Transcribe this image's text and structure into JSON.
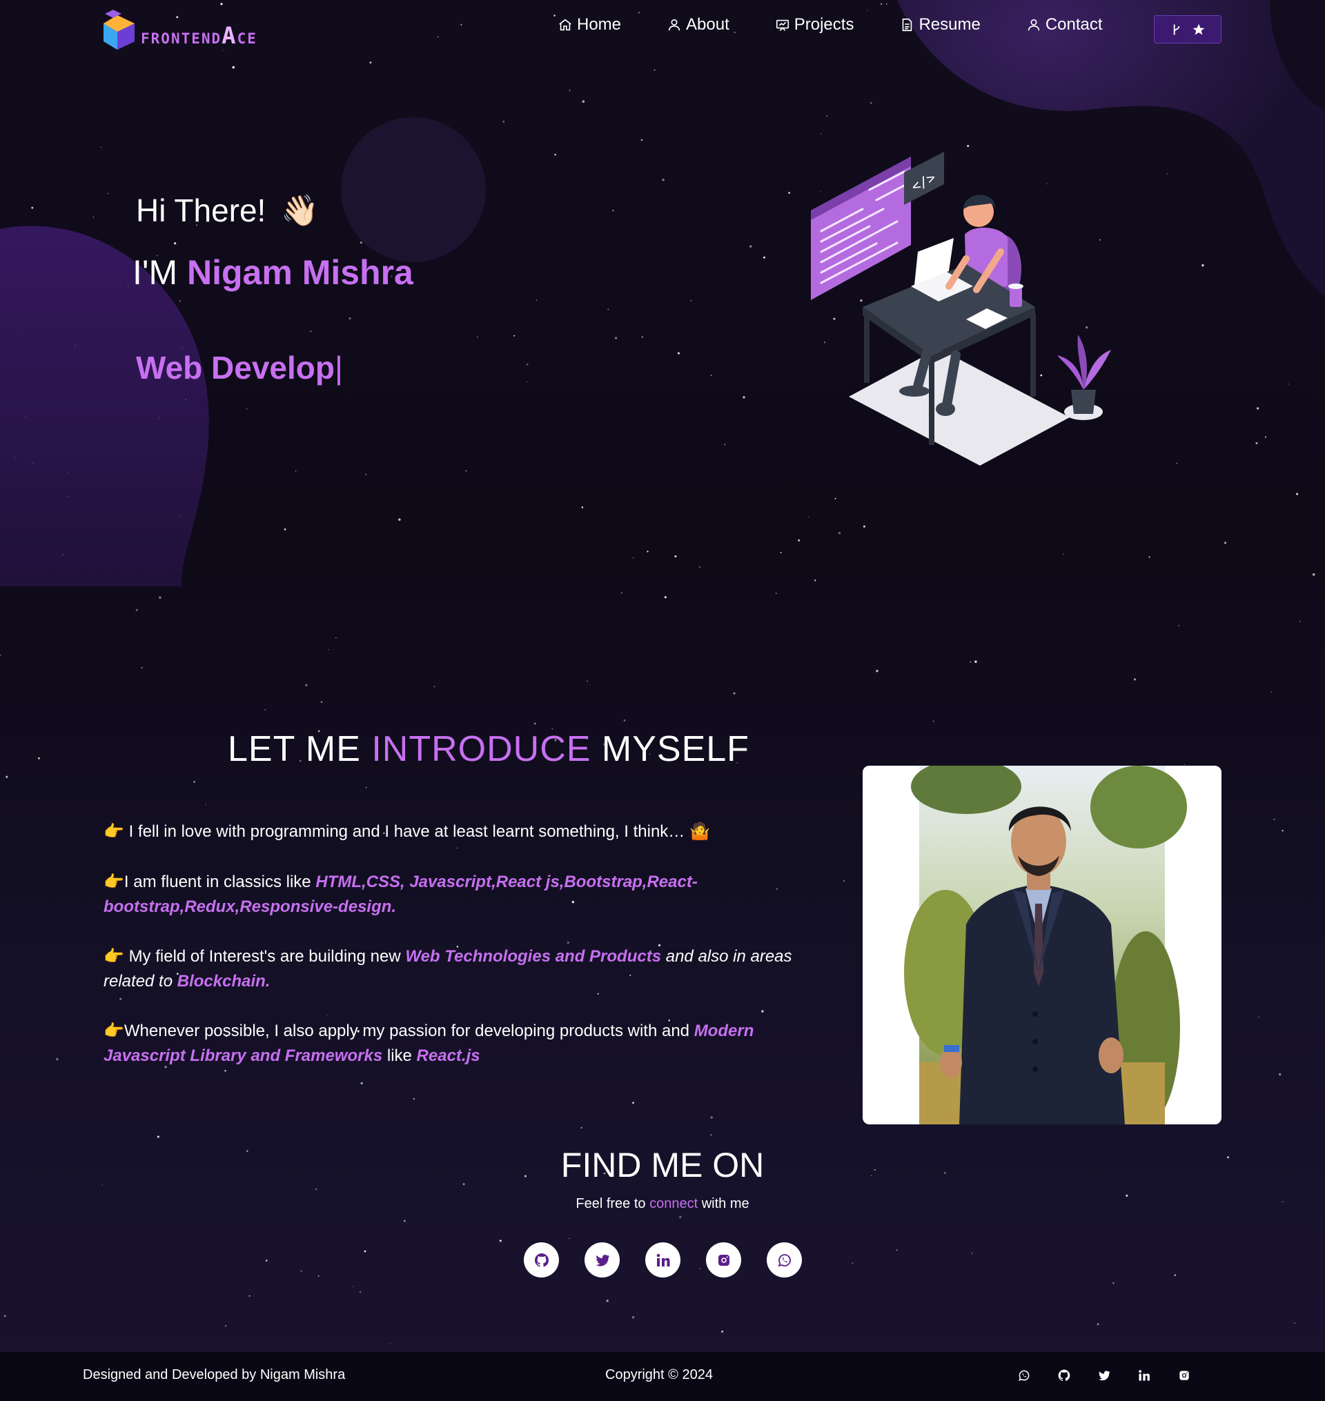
{
  "nav": {
    "logo_text_first": "F",
    "logo_text_mid": "RONTEND",
    "logo_text_big": "A",
    "logo_text_end": "CE",
    "items": [
      {
        "label": "Home",
        "icon": "home-icon"
      },
      {
        "label": "About",
        "icon": "user-icon"
      },
      {
        "label": "Projects",
        "icon": "projects-icon"
      },
      {
        "label": "Resume",
        "icon": "document-icon"
      },
      {
        "label": "Contact",
        "icon": "user-icon"
      }
    ],
    "github_button_icons": [
      "fork-icon",
      "star-icon"
    ]
  },
  "hero": {
    "greeting": "Hi There!",
    "wave_emoji": "👋🏻",
    "name_prefix": "I'M",
    "name": "Nigam Mishra",
    "typed_text": "Web Develop",
    "typed_cursor": "|"
  },
  "intro": {
    "title_start": "LET ME",
    "title_highlight": "INTRODUCE",
    "title_end": "MYSELF",
    "pointer": "👉",
    "p1": {
      "text": "I fell in love with programming and I have at least learnt something, I think…",
      "emoji": "🤷"
    },
    "p2": {
      "text": "I am fluent in classics like ",
      "highlight": "HTML,CSS, Javascript,React js,Bootstrap,React-bootstrap,Redux,Responsive-design."
    },
    "p3": {
      "text": "My field of Interest's are building new ",
      "highlight1": "Web Technologies and Products",
      "italic": " and also in areas related to ",
      "highlight2": "Blockchain."
    },
    "p4": {
      "text": "Whenever possible, I also apply my passion for developing products with and ",
      "highlight1": "Modern Javascript Library and Frameworks",
      "mid": " like ",
      "highlight2": "React.js"
    }
  },
  "find": {
    "title": "FIND ME ON",
    "sub_start": "Feel free to ",
    "sub_highlight": "connect",
    "sub_end": " with me",
    "icons": [
      "github-icon",
      "twitter-icon",
      "linkedin-icon",
      "instagram-icon",
      "whatsapp-icon"
    ]
  },
  "footer": {
    "left": "Designed and Developed by Nigam Mishra",
    "copyright": "Copyright © 2024",
    "icons": [
      "whatsapp-icon",
      "github-icon",
      "twitter-icon",
      "linkedin-icon",
      "instagram-icon"
    ]
  },
  "colors": {
    "accent": "#c770f0",
    "background": "#0e0b18",
    "button": "#3b1a6f"
  }
}
